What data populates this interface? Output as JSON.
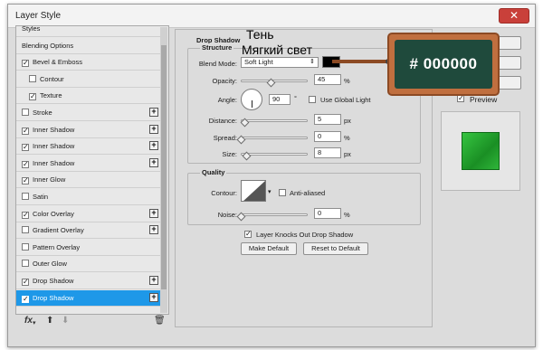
{
  "window": {
    "title": "Layer Style"
  },
  "styles_list": {
    "items": [
      {
        "label": "Styles",
        "checkbox": false,
        "checked": false,
        "plus": false,
        "sub": false,
        "selected": false
      },
      {
        "label": "Blending Options",
        "checkbox": false,
        "checked": false,
        "plus": false,
        "sub": false,
        "selected": false
      },
      {
        "label": "Bevel & Emboss",
        "checkbox": true,
        "checked": true,
        "plus": false,
        "sub": false,
        "selected": false
      },
      {
        "label": "Contour",
        "checkbox": true,
        "checked": false,
        "plus": false,
        "sub": true,
        "selected": false
      },
      {
        "label": "Texture",
        "checkbox": true,
        "checked": true,
        "plus": false,
        "sub": true,
        "selected": false
      },
      {
        "label": "Stroke",
        "checkbox": true,
        "checked": false,
        "plus": true,
        "sub": false,
        "selected": false
      },
      {
        "label": "Inner Shadow",
        "checkbox": true,
        "checked": true,
        "plus": true,
        "sub": false,
        "selected": false
      },
      {
        "label": "Inner Shadow",
        "checkbox": true,
        "checked": true,
        "plus": true,
        "sub": false,
        "selected": false
      },
      {
        "label": "Inner Shadow",
        "checkbox": true,
        "checked": true,
        "plus": true,
        "sub": false,
        "selected": false
      },
      {
        "label": "Inner Glow",
        "checkbox": true,
        "checked": true,
        "plus": false,
        "sub": false,
        "selected": false
      },
      {
        "label": "Satin",
        "checkbox": true,
        "checked": false,
        "plus": false,
        "sub": false,
        "selected": false
      },
      {
        "label": "Color Overlay",
        "checkbox": true,
        "checked": true,
        "plus": true,
        "sub": false,
        "selected": false
      },
      {
        "label": "Gradient Overlay",
        "checkbox": true,
        "checked": false,
        "plus": true,
        "sub": false,
        "selected": false
      },
      {
        "label": "Pattern Overlay",
        "checkbox": true,
        "checked": false,
        "plus": false,
        "sub": false,
        "selected": false
      },
      {
        "label": "Outer Glow",
        "checkbox": true,
        "checked": false,
        "plus": false,
        "sub": false,
        "selected": false
      },
      {
        "label": "Drop Shadow",
        "checkbox": true,
        "checked": true,
        "plus": true,
        "sub": false,
        "selected": false
      },
      {
        "label": "Drop Shadow",
        "checkbox": true,
        "checked": true,
        "plus": true,
        "sub": false,
        "selected": true
      }
    ],
    "footer": {
      "fx": "fx",
      "up_icon": "arrow-up-icon",
      "down_icon": "arrow-down-icon",
      "trash_icon": "trash-icon"
    }
  },
  "drop_shadow": {
    "title": "Drop Shadow",
    "structure_title": "Structure",
    "blend_mode_label": "Blend Mode:",
    "blend_mode_value": "Soft Light",
    "blend_color": "#000000",
    "opacity_label": "Opacity:",
    "opacity_value": "45",
    "angle_label": "Angle:",
    "angle_value": "90",
    "degree_symbol": "°",
    "use_global_light_label": "Use Global Light",
    "use_global_light_checked": false,
    "distance_label": "Distance:",
    "distance_value": "5",
    "spread_label": "Spread:",
    "spread_value": "0",
    "size_label": "Size:",
    "size_value": "8",
    "unit_px": "px",
    "unit_percent": "%",
    "quality_title": "Quality",
    "contour_label": "Contour:",
    "anti_aliased_label": "Anti-aliased",
    "anti_aliased_checked": false,
    "noise_label": "Noise:",
    "noise_value": "0",
    "knocks_out_label": "Layer Knocks Out Drop Shadow",
    "knocks_out_checked": true,
    "make_default_label": "Make Default",
    "reset_default_label": "Reset to Default",
    "slider_levels": {
      "opacity": 0.45,
      "distance": 0.05,
      "spread": 0.0,
      "size": 0.08,
      "noise": 0.0
    }
  },
  "side": {
    "preview_label": "Preview",
    "preview_checked": true,
    "swatch_color": "#2db23a"
  },
  "annotations": {
    "line1": "Тень",
    "line2": "Мягкий свет",
    "hex_badge": "# 000000"
  },
  "colors": {
    "selection": "#1e98e8",
    "badge_wood": "#c06f3f",
    "badge_board": "#1f4a3c"
  }
}
